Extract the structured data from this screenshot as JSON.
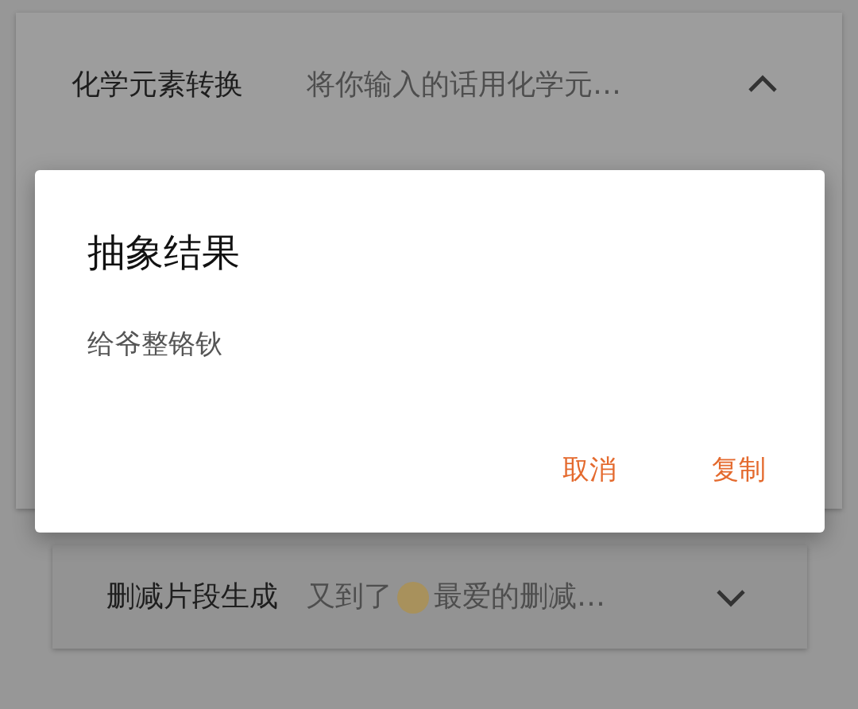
{
  "panels": [
    {
      "title": "化学元素转换",
      "description_parts": [
        "将你输入的话用化学元…"
      ],
      "expanded": true
    },
    {
      "title": "删减片段生成",
      "description_parts": [
        "又到了",
        "最爱的删减…"
      ],
      "expanded": false
    }
  ],
  "dialog": {
    "title": "抽象结果",
    "result": "给爷整铬钬",
    "buttons": [
      "取消",
      "复制"
    ]
  }
}
